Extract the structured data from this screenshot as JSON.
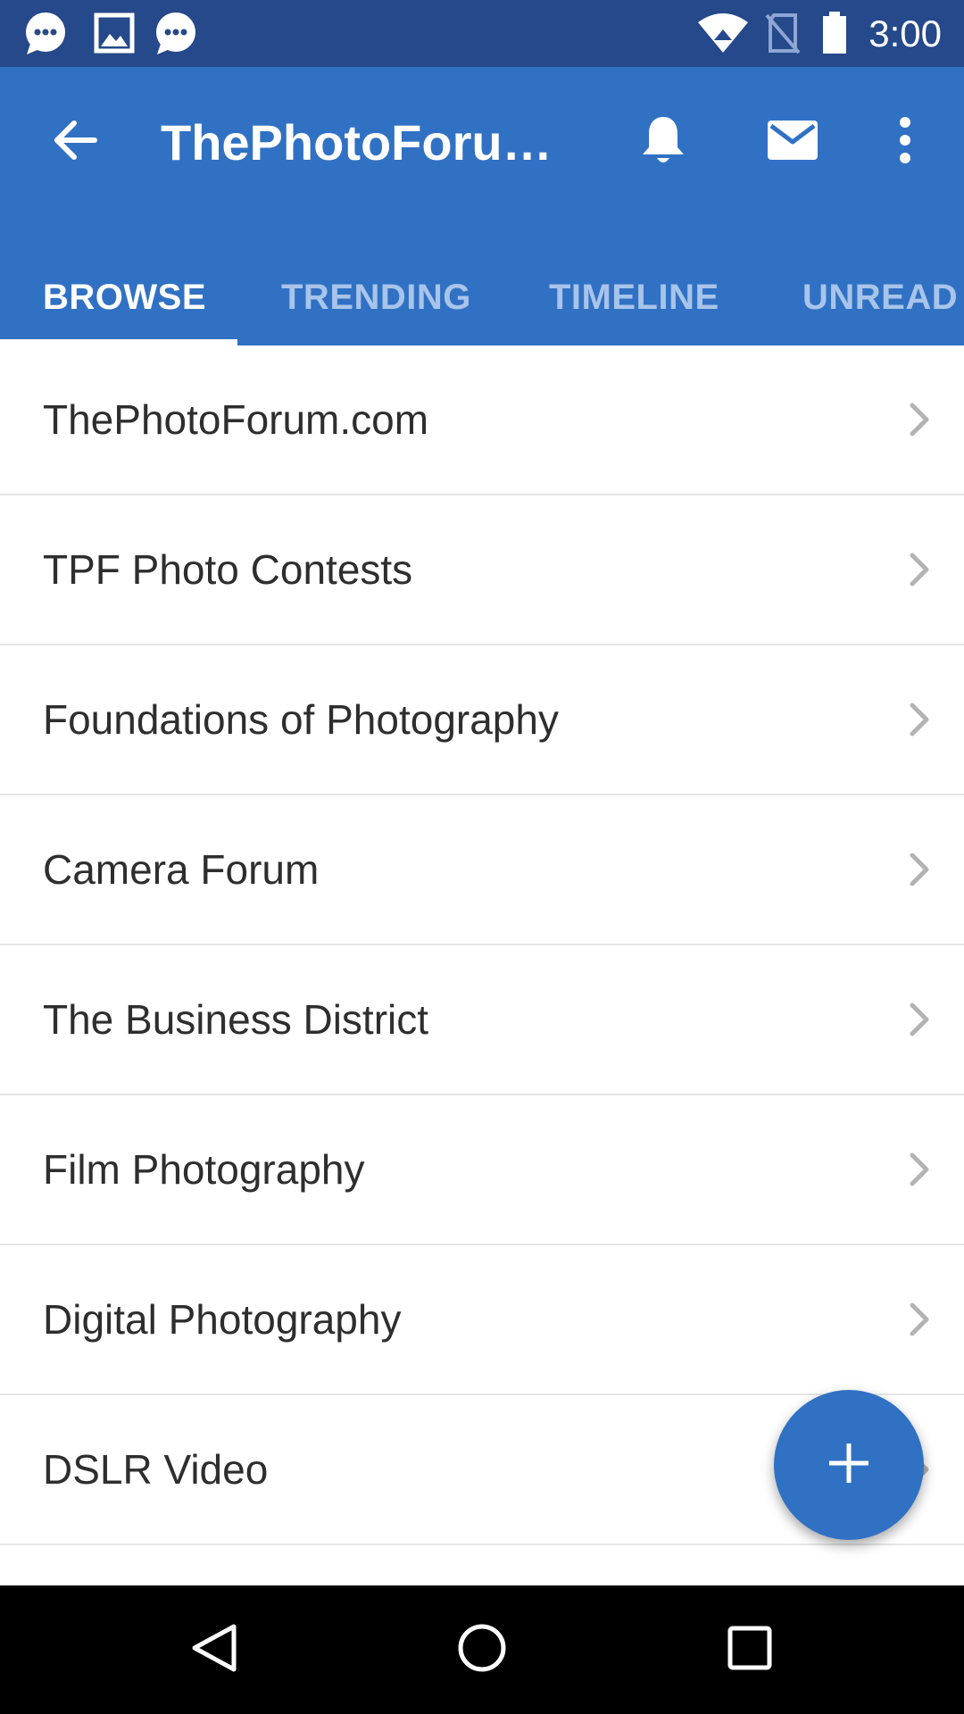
{
  "status_bar": {
    "time": "3:00",
    "left_icons": [
      "chat-bubble-icon",
      "image-icon",
      "chat-bubble-icon"
    ],
    "right_icons": [
      "wifi-icon",
      "no-sim-icon",
      "battery-icon"
    ]
  },
  "app_bar": {
    "title": "ThePhotoForum.com",
    "back_icon": "arrow-back-icon",
    "actions": [
      "bell-icon",
      "mail-icon",
      "more-vert-icon"
    ]
  },
  "tabs": [
    {
      "label": "BROWSE",
      "active": true
    },
    {
      "label": "TRENDING",
      "active": false
    },
    {
      "label": "TIMELINE",
      "active": false
    },
    {
      "label": "UNREAD",
      "active": false
    }
  ],
  "forums": [
    {
      "label": "ThePhotoForum.com"
    },
    {
      "label": "TPF Photo Contests"
    },
    {
      "label": "Foundations of Photography"
    },
    {
      "label": "Camera Forum"
    },
    {
      "label": "The Business District"
    },
    {
      "label": "Film Photography"
    },
    {
      "label": "Digital Photography"
    },
    {
      "label": "DSLR Video"
    }
  ],
  "fab": {
    "icon": "plus-icon"
  },
  "colors": {
    "status_bar": "#25498a",
    "primary": "#3071c4",
    "tab_inactive": "#a9c4ea",
    "divider": "#e6e6e6",
    "chevron": "#b3b3b3"
  }
}
